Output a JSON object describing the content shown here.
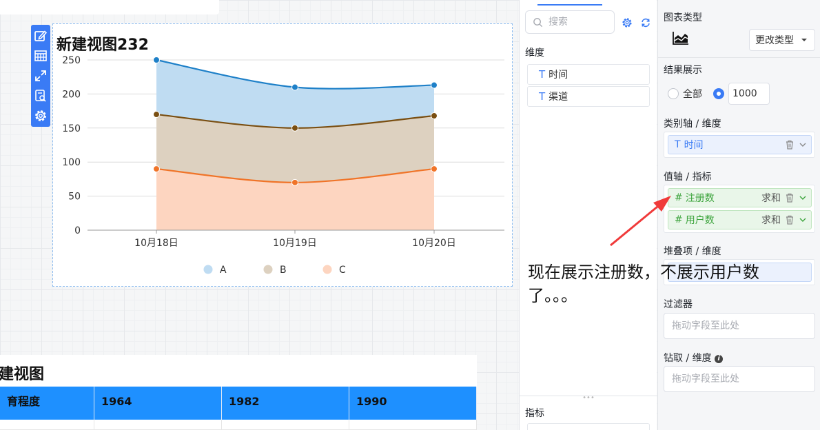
{
  "chart": {
    "title": "新建视图232",
    "toolbar": [
      {
        "name": "edit-icon"
      },
      {
        "name": "data-view-icon"
      },
      {
        "name": "expand-icon"
      },
      {
        "name": "inspect-icon"
      },
      {
        "name": "settings-icon"
      }
    ]
  },
  "chart_data": {
    "type": "area",
    "stacked": true,
    "categories": [
      "10月18日",
      "10月19日",
      "10月20日"
    ],
    "series": [
      {
        "name": "A",
        "values": [
          250,
          210,
          213
        ],
        "color": "#1e80c8",
        "fill": "#bfdcf2"
      },
      {
        "name": "B",
        "values": [
          170,
          150,
          168
        ],
        "color": "#7a4f12",
        "fill": "#ddd1c0"
      },
      {
        "name": "C",
        "values": [
          90,
          70,
          90
        ],
        "color": "#f07428",
        "fill": "#fdd5c0"
      }
    ],
    "yticks": [
      "0",
      "50",
      "100",
      "150",
      "200",
      "250"
    ],
    "ylim": [
      0,
      250
    ],
    "grid": true,
    "legend_position": "bottom"
  },
  "table": {
    "title": "建视图",
    "headers": [
      "育程度",
      "1964",
      "1982",
      "1990"
    ]
  },
  "field_panel": {
    "search_placeholder": "搜索",
    "dimensions_label": "维度",
    "dimensions": [
      {
        "type": "T",
        "label": "时间"
      },
      {
        "type": "T",
        "label": "渠道"
      }
    ],
    "metrics_label": "指标"
  },
  "config": {
    "chart_type_label": "图表类型",
    "change_type_label": "更改类型",
    "result_label": "结果展示",
    "result_all": "全部",
    "result_limit": "1000",
    "category_axis_label": "类别轴 / 维度",
    "category_chip": {
      "type": "T",
      "label": "时间"
    },
    "value_axis_label": "值轴 / 指标",
    "value_chips": [
      {
        "type": "#",
        "label": "注册数",
        "agg": "求和"
      },
      {
        "type": "#",
        "label": "用户数",
        "agg": "求和"
      }
    ],
    "stack_label": "堆叠项 / 维度",
    "filter_label": "过滤器",
    "filter_placeholder": "拖动字段至此处",
    "drill_label": "钻取 / 维度",
    "drill_placeholder": "拖动字段至此处"
  },
  "annotation": {
    "text": "现在展示注册数，不展示用户数了。。。",
    "arrow_color": "#f03a3a"
  }
}
